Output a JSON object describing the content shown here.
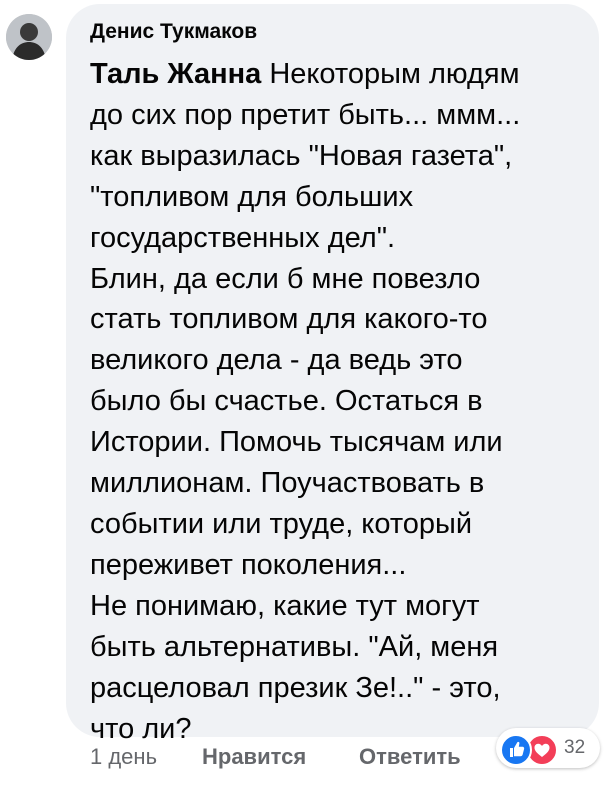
{
  "comment": {
    "author": "Денис Тукмаков",
    "mention": "Таль Жанна",
    "lines": [
      " Некоторым людям",
      "до сих пор претит быть... ммм...",
      "как выразилась \"Новая газета\",",
      "\"топливом для больших",
      "государственных дел\".",
      "Блин, да если б мне повезло",
      "стать топливом для какого-то",
      "великого дела - да ведь это",
      "было бы счастье. Остаться в",
      "Истории. Помочь тысячам или",
      "миллионам. Поучаствовать в",
      "событии или труде, который",
      "переживет поколения...",
      "Не понимаю, какие тут могут",
      "быть альтернативы. \"Ай, меня",
      "расцеловал презик Зе!..\" - это,",
      "что ли?"
    ]
  },
  "actions": {
    "time": "1 день",
    "like_label": "Нравится",
    "reply_label": "Ответить"
  },
  "reactions": {
    "icons": [
      "like-icon",
      "love-icon"
    ],
    "count": "32"
  },
  "colors": {
    "bubble": "#f0f2f5",
    "like": "#1877f2",
    "love": "#f33e58",
    "meta_text": "#65676b"
  }
}
